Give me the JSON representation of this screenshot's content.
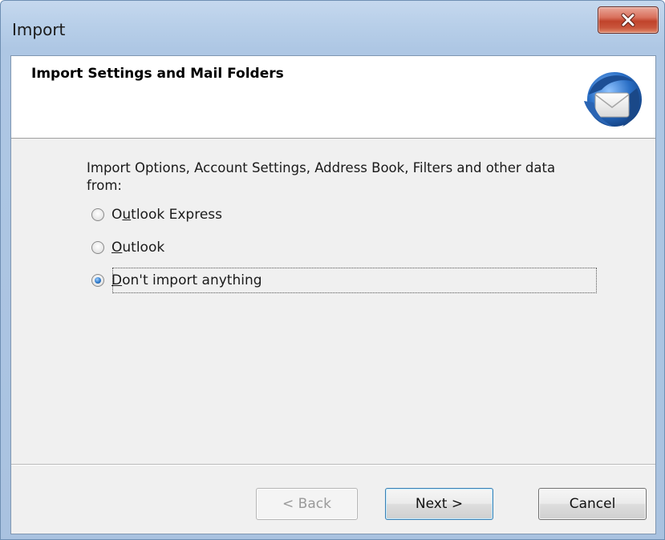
{
  "window": {
    "title": "Import"
  },
  "header": {
    "title": "Import Settings and Mail Folders",
    "logo_icon": "thunderbird-logo-icon"
  },
  "body": {
    "prompt": "Import Options, Account Settings, Address Book, Filters and other data from:",
    "options": [
      {
        "pre": "O",
        "acc": "u",
        "post": "tlook Express",
        "selected": false
      },
      {
        "pre": "",
        "acc": "O",
        "post": "utlook",
        "selected": false
      },
      {
        "pre": "",
        "acc": "D",
        "post": "on't import anything",
        "selected": true
      }
    ]
  },
  "footer": {
    "back_label": "< Back",
    "next_label": "Next >",
    "cancel_label": "Cancel"
  },
  "colors": {
    "titlebar": "#b8cfe9",
    "close_button": "#c9563c",
    "panel": "#f0f0f0",
    "header": "#ffffff"
  }
}
